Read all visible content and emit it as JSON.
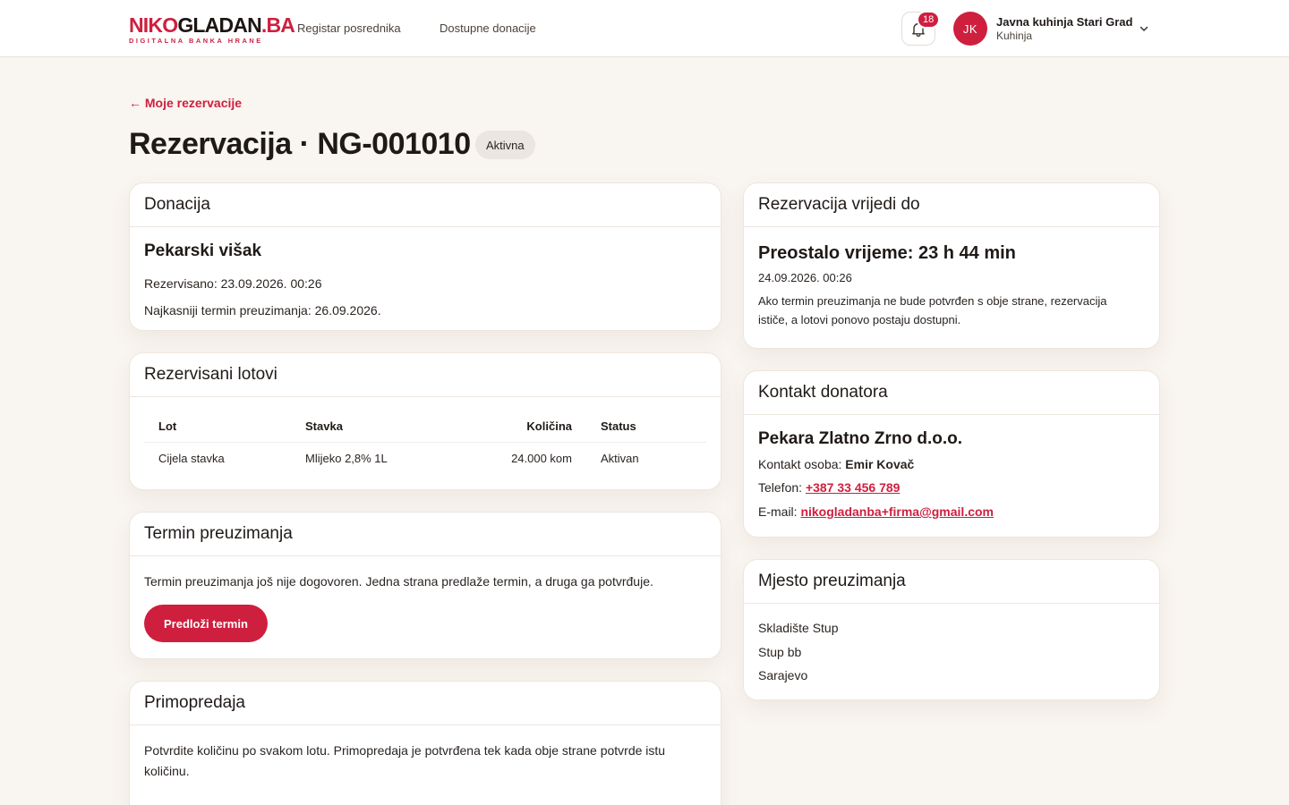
{
  "brand": {
    "logo_red": "NIKO",
    "logo_dark": "GLADAN",
    "logo_tld": ".BA",
    "tagline": "DIGITALNA BANKA HRANE",
    "accent_color": "#cf1f3e"
  },
  "nav": {
    "items": [
      {
        "label": "Registar posrednika"
      },
      {
        "label": "Dostupne donacije"
      }
    ]
  },
  "notifications": {
    "count": "18",
    "icon": "bell-icon"
  },
  "user": {
    "initials": "JK",
    "name": "Javna kuhinja Stari Grad",
    "role": "Kuhinja"
  },
  "page": {
    "back_label": "← Moje rezervacije",
    "title": "Rezervacija · NG-001010",
    "status": "Aktivna"
  },
  "donacija": {
    "heading": "Donacija",
    "name": "Pekarski višak",
    "reserved": "Rezervisano: 23.09.2026. 00:26",
    "deadline": "Najkasniji termin preuzimanja: 26.09.2026."
  },
  "lotovi": {
    "heading": "Rezervisani lotovi",
    "columns": [
      "Lot",
      "Stavka",
      "Količina",
      "Status"
    ],
    "rows": [
      {
        "lot": "Cijela stavka",
        "stavka": "Mlijeko 2,8% 1L",
        "kolicina": "24.000 kom",
        "status": "Aktivan"
      }
    ]
  },
  "termin": {
    "heading": "Termin preuzimanja",
    "text": "Termin preuzimanja još nije dogovoren. Jedna strana predlaže termin, a druga ga potvrđuje.",
    "button": "Predloži termin"
  },
  "primopredaja": {
    "heading": "Primopredaja",
    "text": "Potvrdite količinu po svakom lotu. Primopredaja je potvrđena tek kada obje strane potvrde istu količinu."
  },
  "vrijedi": {
    "heading": "Rezervacija vrijedi do",
    "remaining": "Preostalo vrijeme: 23 h 44 min",
    "date": "24.09.2026. 00:26",
    "note": "Ako termin preuzimanja ne bude potvrđen s obje strane, rezervacija ističe, a lotovi ponovo postaju dostupni."
  },
  "kontakt": {
    "heading": "Kontakt donatora",
    "company": "Pekara Zlatno Zrno d.o.o.",
    "person_label": "Kontakt osoba:",
    "person": "Emir Kovač",
    "phone_label": "Telefon:",
    "phone": "+387 33 456 789",
    "email_label": "E-mail:",
    "email": "nikogladanba+firma@gmail.com"
  },
  "mjesto": {
    "heading": "Mjesto preuzimanja",
    "lines": [
      "Skladište Stup",
      "Stup bb",
      "Sarajevo"
    ]
  }
}
